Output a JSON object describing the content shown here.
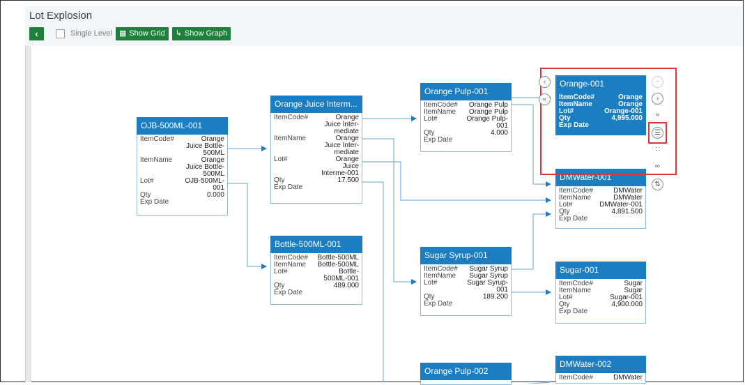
{
  "page": {
    "title": "Lot Explosion"
  },
  "toolbar": {
    "back_icon": "chevron-left-icon",
    "single_level_label": "Single Level",
    "single_level_checked": false,
    "show_grid_label": "Show Grid",
    "show_graph_label": "Show Graph"
  },
  "colors": {
    "accent_blue": "#1b7ec2",
    "button_green": "#1f7f3c",
    "highlight_red": "#d23a3a"
  },
  "nodes": {
    "ojb": {
      "title": "OJB-500ML-001",
      "rows": [
        {
          "k": "ItemCode#",
          "v": "Orange\nJuice Bottle-\n500ML"
        },
        {
          "k": "ItemName",
          "v": "Orange\nJuice Bottle-\n500ML"
        },
        {
          "k": "Lot#",
          "v": "OJB-500ML-\n001"
        },
        {
          "k": "Qty",
          "v": "0.000"
        },
        {
          "k": "Exp Date",
          "v": ""
        }
      ]
    },
    "oji": {
      "title": "Orange Juice Interm...",
      "rows": [
        {
          "k": "ItemCode#",
          "v": "Orange\nJuice Inter-\nmediate"
        },
        {
          "k": "ItemName",
          "v": "Orange\nJuice Inter-\nmediate"
        },
        {
          "k": "Lot#",
          "v": "Orange\nJuice\nInterme-001"
        },
        {
          "k": "Qty",
          "v": "17.500"
        },
        {
          "k": "Exp Date",
          "v": ""
        }
      ]
    },
    "bottle": {
      "title": "Bottle-500ML-001",
      "rows": [
        {
          "k": "ItemCode#",
          "v": "Bottle-500ML"
        },
        {
          "k": "ItemName",
          "v": "Bottle-500ML"
        },
        {
          "k": "Lot#",
          "v": "Bottle-\n500ML-001"
        },
        {
          "k": "Qty",
          "v": "489.000"
        },
        {
          "k": "Exp Date",
          "v": ""
        }
      ]
    },
    "pulp1": {
      "title": "Orange Pulp-001",
      "rows": [
        {
          "k": "ItemCode#",
          "v": "Orange Pulp"
        },
        {
          "k": "ItemName",
          "v": "Orange Pulp"
        },
        {
          "k": "Lot#",
          "v": "Orange Pulp-\n001"
        },
        {
          "k": "Qty",
          "v": "4.000"
        },
        {
          "k": "Exp Date",
          "v": ""
        }
      ]
    },
    "syrup": {
      "title": "Sugar Syrup-001",
      "rows": [
        {
          "k": "ItemCode#",
          "v": "Sugar Syrup"
        },
        {
          "k": "ItemName",
          "v": "Sugar Syrup"
        },
        {
          "k": "Lot#",
          "v": "Sugar Syrup-\n001"
        },
        {
          "k": "Qty",
          "v": "189.200"
        },
        {
          "k": "Exp Date",
          "v": ""
        }
      ]
    },
    "pulp2": {
      "title": "Orange Pulp-002",
      "rows": []
    },
    "orange": {
      "title": "Orange-001",
      "rows": [
        {
          "k": "ItemCode#",
          "v": "Orange"
        },
        {
          "k": "ItemName",
          "v": "Orange"
        },
        {
          "k": "Lot#",
          "v": "Orange-001"
        },
        {
          "k": "Qty",
          "v": "4,995.000"
        },
        {
          "k": "Exp Date",
          "v": ""
        }
      ]
    },
    "dmw1": {
      "title": "DMWater-001",
      "rows": [
        {
          "k": "ItemCode#",
          "v": "DMWater"
        },
        {
          "k": "ItemName",
          "v": "DMWater"
        },
        {
          "k": "Lot#",
          "v": "DMWater-001"
        },
        {
          "k": "Qty",
          "v": "4,891.500"
        },
        {
          "k": "Exp Date",
          "v": ""
        }
      ]
    },
    "sugar": {
      "title": "Sugar-001",
      "rows": [
        {
          "k": "ItemCode#",
          "v": "Sugar"
        },
        {
          "k": "ItemName",
          "v": "Sugar"
        },
        {
          "k": "Lot#",
          "v": "Sugar-001"
        },
        {
          "k": "Qty",
          "v": "4,900.000"
        },
        {
          "k": "Exp Date",
          "v": ""
        }
      ]
    },
    "dmw2": {
      "title": "DMWater-002",
      "rows": [
        {
          "k": "ItemCode#",
          "v": "DMWater"
        }
      ]
    }
  },
  "controls": {
    "collapse_left": "chevron-left-icon",
    "collapse_all_left": "double-chevron-left-icon",
    "minus": "minus-circle-icon",
    "expand_right": "chevron-right-icon",
    "expand_all_right": "double-chevron-right-icon",
    "details": "list-details-icon",
    "hierarchy": "org-chart-icon",
    "link": "link-icon",
    "sort": "sort-icon"
  }
}
